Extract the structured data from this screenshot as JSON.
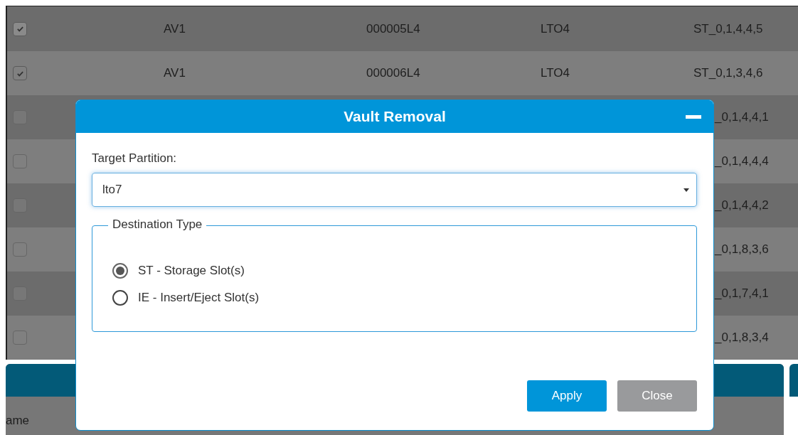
{
  "table": {
    "rows": [
      {
        "checked": true,
        "column_2": "AV1",
        "column_3": "000005L4",
        "column_4": "LTO4",
        "column_5": "ST_0,1,4,4,5"
      },
      {
        "checked": true,
        "column_2": "AV1",
        "column_3": "000006L4",
        "column_4": "LTO4",
        "column_5": "ST_0,1,3,4,6"
      },
      {
        "checked": false,
        "column_5": "_0,1,4,4,1"
      },
      {
        "checked": false,
        "column_5": "_0,1,4,4,4"
      },
      {
        "checked": false,
        "column_5": "_0,1,4,4,2"
      },
      {
        "checked": false,
        "column_5": "_0,1,8,3,6"
      },
      {
        "checked": false,
        "column_5": "_0,1,7,4,1"
      },
      {
        "checked": false,
        "column_5": "_0,1,8,3,4"
      }
    ]
  },
  "bottom_panel": {
    "label": "ame"
  },
  "dialog": {
    "title": "Vault Removal",
    "target_partition": {
      "label": "Target Partition:",
      "value": "lto7"
    },
    "destination_type": {
      "legend": "Destination Type",
      "options": [
        {
          "label": "ST - Storage Slot(s)",
          "selected": true
        },
        {
          "label": "IE - Insert/Eject Slot(s)",
          "selected": false
        }
      ]
    },
    "buttons": [
      {
        "label": "Apply",
        "kind": "primary"
      },
      {
        "label": "Close",
        "kind": "secondary"
      }
    ]
  }
}
